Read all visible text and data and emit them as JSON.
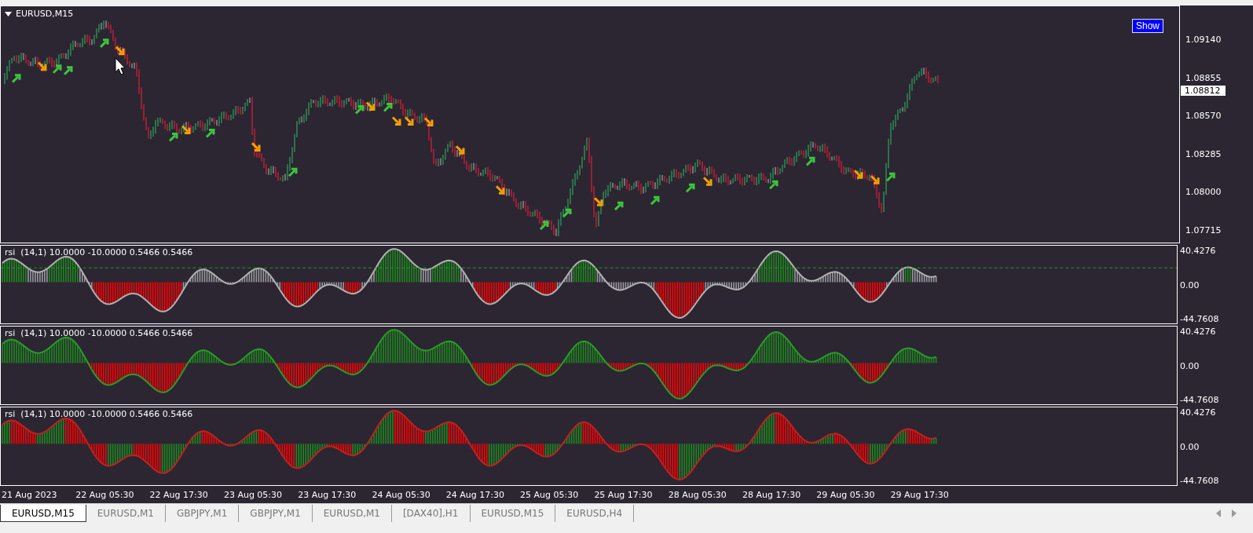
{
  "chart": {
    "symbol": "EURUSD,M15",
    "show_button": "Show",
    "price_axis": [
      "1.09140",
      "1.08855",
      "1.08570",
      "1.08285",
      "1.08000",
      "1.07715"
    ],
    "current_price": "1.08812"
  },
  "indicator_panes": [
    {
      "kind": "threshold",
      "label": "rsi  (14,1) 10.0000 -10.0000 0.5466 0.5466",
      "axis": [
        "40.4276",
        "0.00",
        "-44.7608"
      ]
    },
    {
      "kind": "sign",
      "label": "rsi  (14,1) 10.0000 -10.0000 0.5466 0.5466",
      "axis": [
        "40.4276",
        "0.00",
        "-44.7608"
      ]
    },
    {
      "kind": "slope",
      "label": "rsi  (14,1) 10.0000 -10.0000 0.5466 0.5466",
      "axis": [
        "40.4276",
        "0.00",
        "-44.7608"
      ]
    }
  ],
  "time_axis": [
    "21 Aug 2023",
    "22 Aug 05:30",
    "22 Aug 17:30",
    "23 Aug 05:30",
    "23 Aug 17:30",
    "24 Aug 05:30",
    "24 Aug 17:30",
    "25 Aug 05:30",
    "25 Aug 17:30",
    "28 Aug 05:30",
    "28 Aug 17:30",
    "29 Aug 05:30",
    "29 Aug 17:30"
  ],
  "tabs": [
    {
      "label": "EURUSD,M15",
      "selected": true
    },
    {
      "label": "EURUSD,M1",
      "selected": false
    },
    {
      "label": "GBPJPY,M1",
      "selected": false
    },
    {
      "label": "GBPJPY,M1",
      "selected": false
    },
    {
      "label": "EURUSD,M1",
      "selected": false
    },
    {
      "label": "[DAX40],H1",
      "selected": false
    },
    {
      "label": "EURUSD,M15",
      "selected": false
    },
    {
      "label": "EURUSD,H4",
      "selected": false
    }
  ]
}
